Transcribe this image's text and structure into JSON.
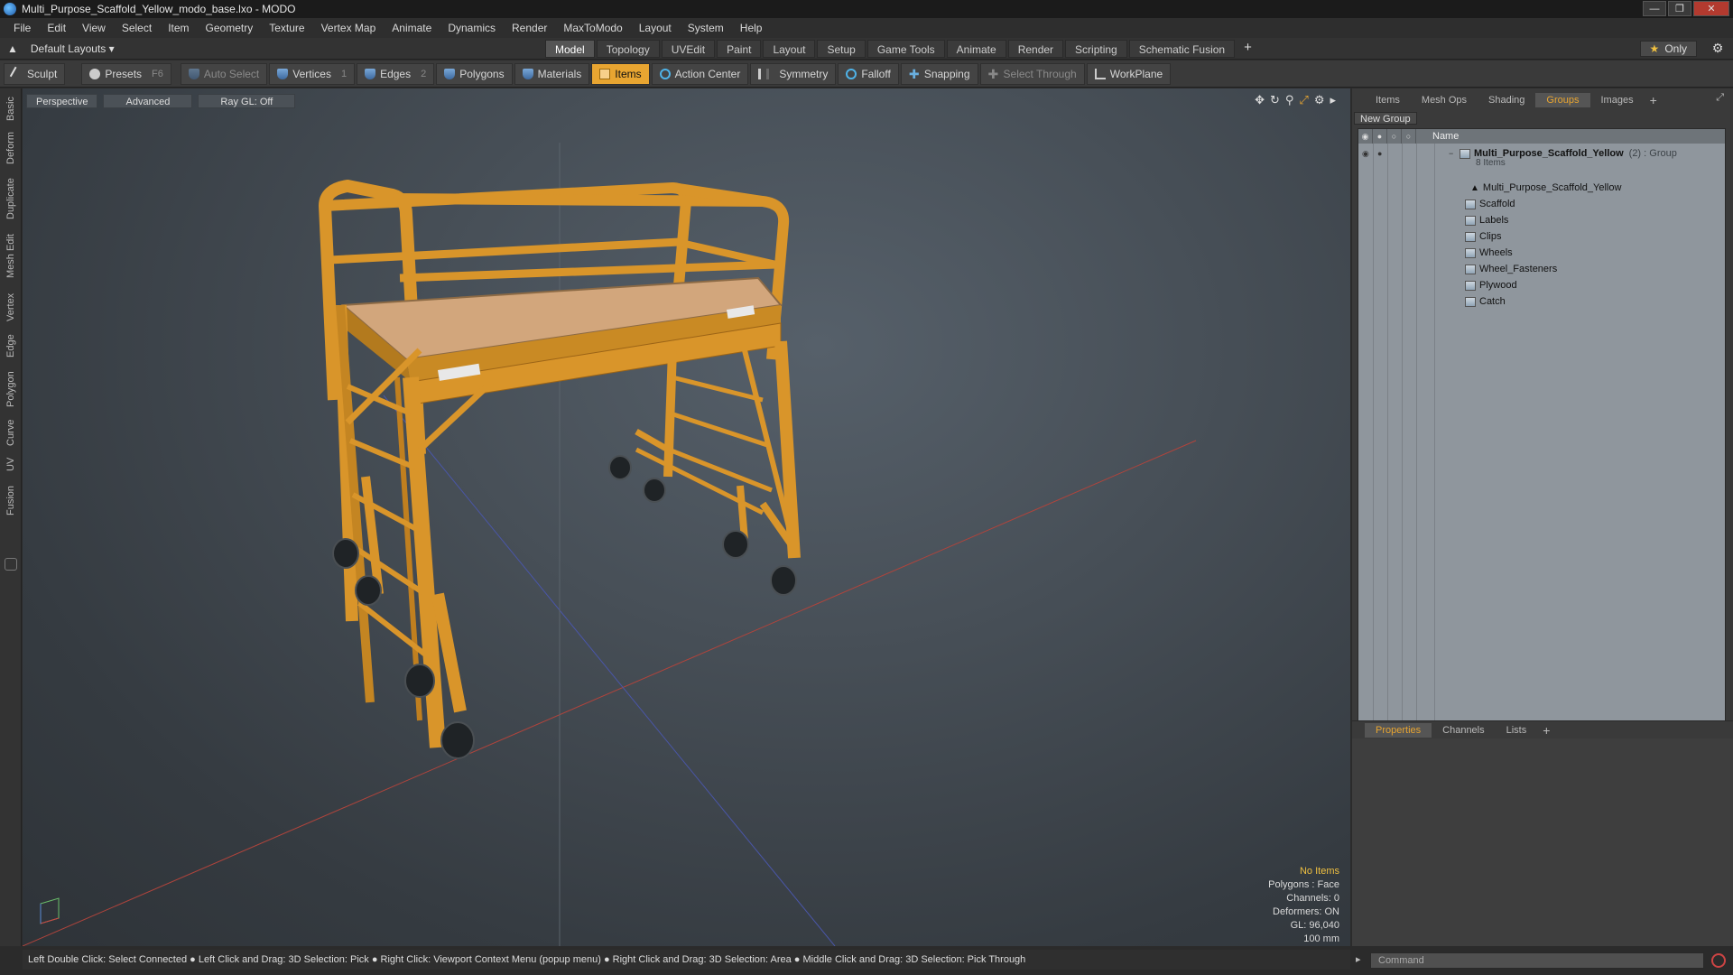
{
  "window": {
    "title": "Multi_Purpose_Scaffold_Yellow_modo_base.lxo - MODO"
  },
  "menu": [
    "File",
    "Edit",
    "View",
    "Select",
    "Item",
    "Geometry",
    "Texture",
    "Vertex Map",
    "Animate",
    "Dynamics",
    "Render",
    "MaxToModo",
    "Layout",
    "System",
    "Help"
  ],
  "layout_bar": {
    "layout_name": "Default Layouts",
    "tabs": [
      "Model",
      "Topology",
      "UVEdit",
      "Paint",
      "Layout",
      "Setup",
      "Game Tools",
      "Animate",
      "Render",
      "Scripting",
      "Schematic Fusion"
    ],
    "active_tab": "Model",
    "only_label": "Only"
  },
  "toolbar": {
    "sculpt": "Sculpt",
    "presets": "Presets",
    "presets_key": "F6",
    "auto_select": "Auto Select",
    "vertices": "Vertices",
    "vertices_count": "1",
    "edges": "Edges",
    "edges_count": "2",
    "polygons": "Polygons",
    "materials": "Materials",
    "items": "Items",
    "action_center": "Action Center",
    "symmetry": "Symmetry",
    "falloff": "Falloff",
    "snapping": "Snapping",
    "select_through": "Select Through",
    "workplane": "WorkPlane"
  },
  "left_tabs": [
    "Basic",
    "Deform",
    "Duplicate",
    "Mesh Edit",
    "Vertex",
    "Edge",
    "Polygon",
    "Curve",
    "UV",
    "Fusion"
  ],
  "viewport": {
    "perspective": "Perspective",
    "advanced": "Advanced",
    "raygl": "Ray GL: Off",
    "info": {
      "selection": "No Items",
      "polygons": "Polygons : Face",
      "channels": "Channels: 0",
      "deformers": "Deformers: ON",
      "gl": "GL: 96,040",
      "scale": "100 mm"
    }
  },
  "right_panel": {
    "tabs": [
      "Items",
      "Mesh Ops",
      "Shading",
      "Groups",
      "Images"
    ],
    "active_tab": "Groups",
    "new_group": "New Group",
    "name_header": "Name",
    "group": {
      "name": "Multi_Purpose_Scaffold_Yellow",
      "suffix": "(2) : Group",
      "count": "8 Items"
    },
    "items": [
      "Multi_Purpose_Scaffold_Yellow",
      "Scaffold",
      "Labels",
      "Clips",
      "Wheels",
      "Wheel_Fasteners",
      "Plywood",
      "Catch"
    ],
    "bottom_tabs": [
      "Properties",
      "Channels",
      "Lists"
    ],
    "bottom_active": "Properties"
  },
  "status_bar": "Left Double Click: Select Connected ● Left Click and Drag: 3D Selection: Pick ● Right Click: Viewport Context Menu (popup menu) ● Right Click and Drag: 3D Selection: Area ● Middle Click and Drag: 3D Selection: Pick Through",
  "command_placeholder": "Command",
  "colors": {
    "accent": "#e8a531",
    "scaffold": "#d9952a",
    "viewport_bg": "#474f57"
  }
}
